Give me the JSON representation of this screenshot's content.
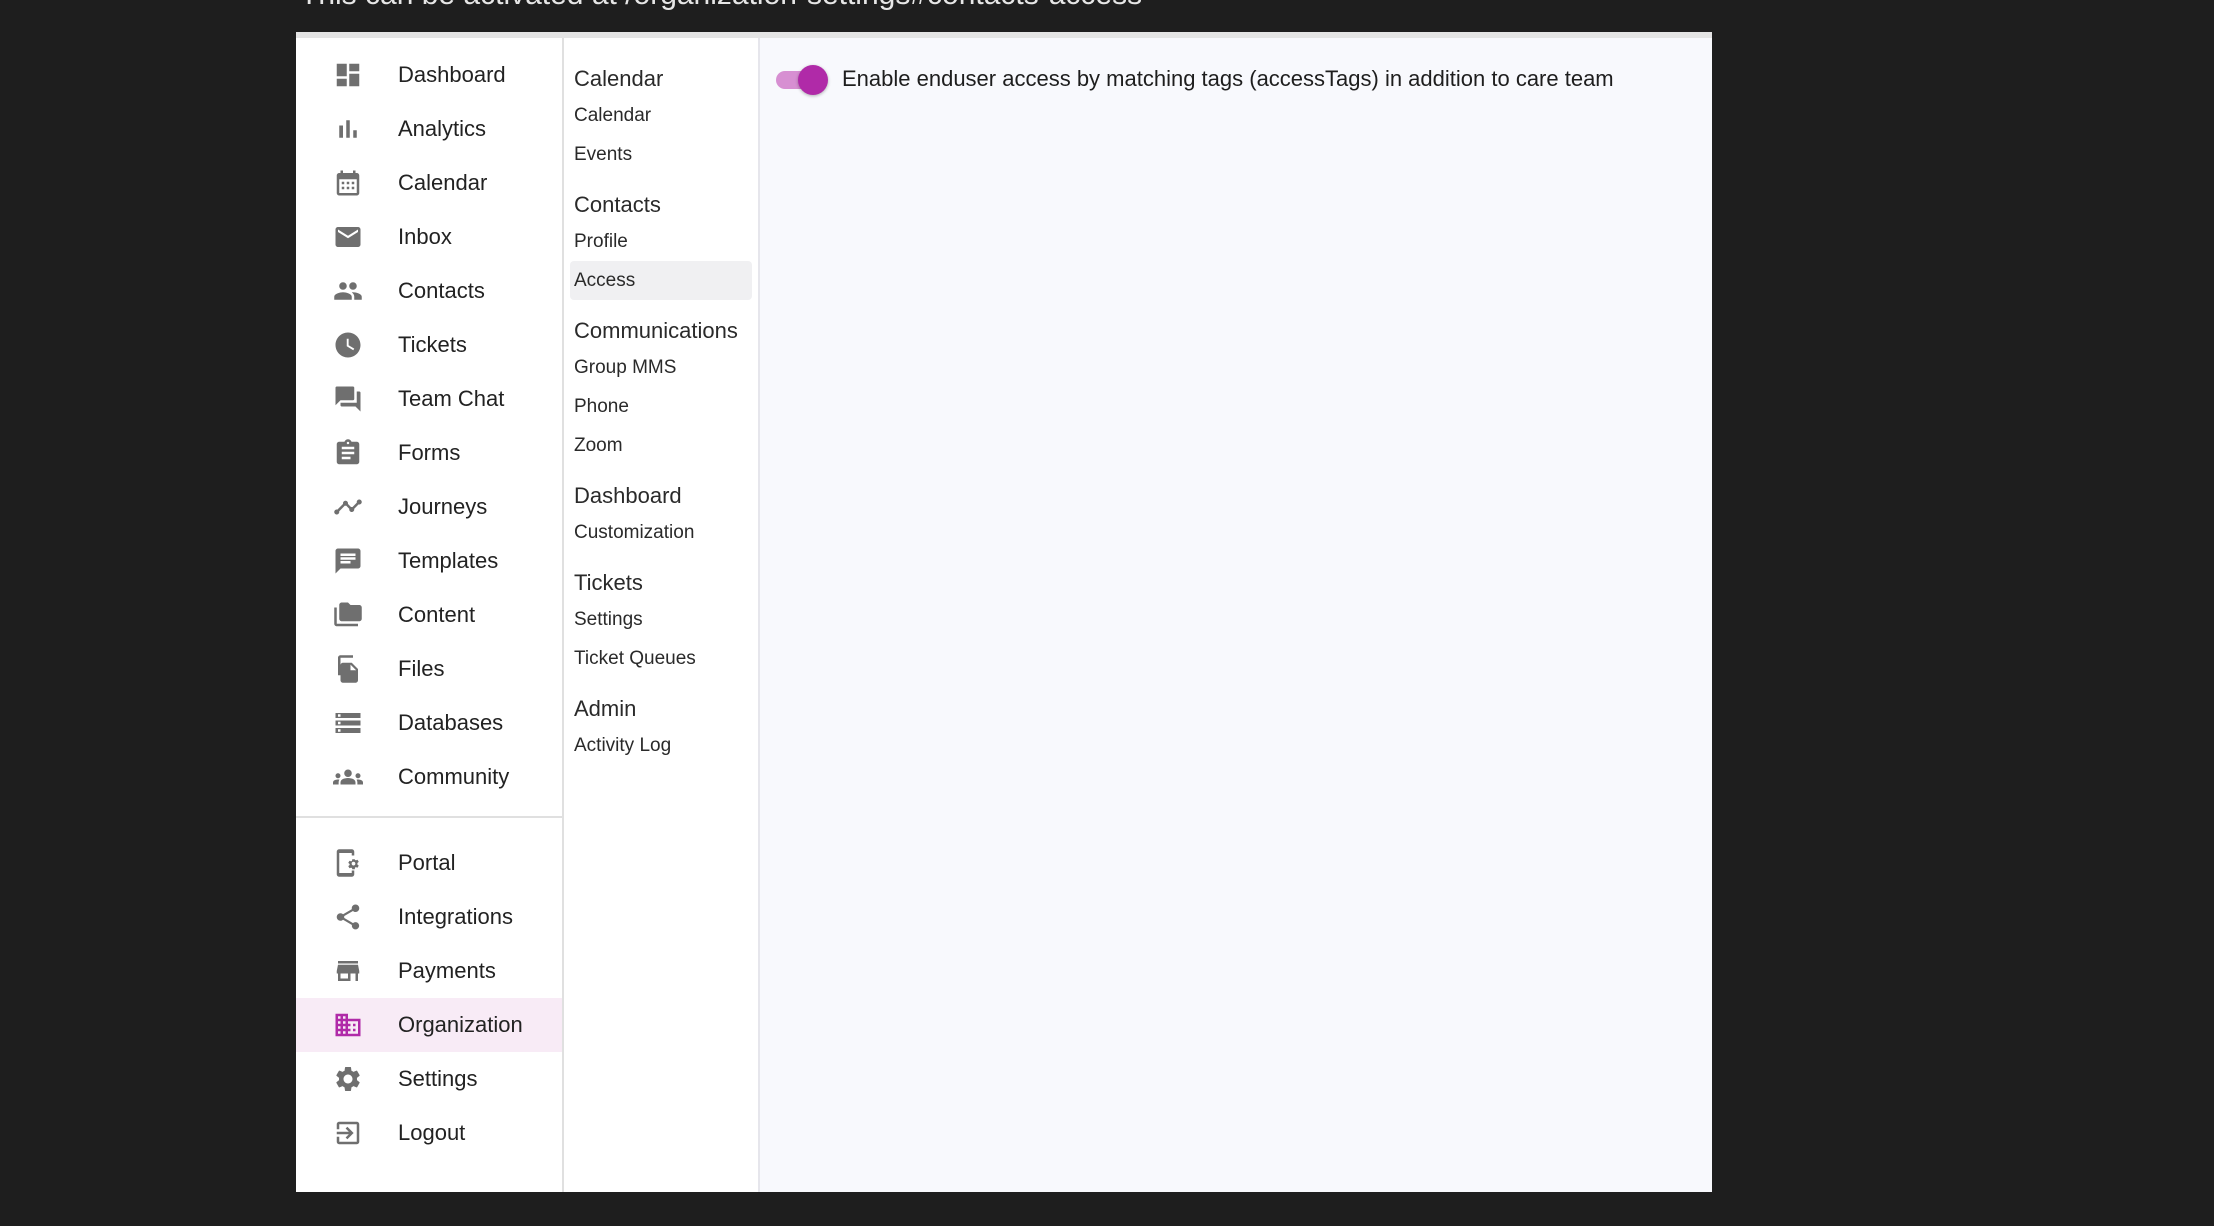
{
  "caption": "This can be activated at /organization-settings#contacts-access",
  "colors": {
    "accent": "#b02aa8",
    "accent_light": "#d78fd2",
    "active_bg": "#f8ebf6"
  },
  "main_nav": {
    "items": [
      {
        "label": "Dashboard",
        "icon": "dashboard-icon"
      },
      {
        "label": "Analytics",
        "icon": "bar-chart-icon"
      },
      {
        "label": "Calendar",
        "icon": "calendar-icon"
      },
      {
        "label": "Inbox",
        "icon": "mail-icon"
      },
      {
        "label": "Contacts",
        "icon": "people-icon"
      },
      {
        "label": "Tickets",
        "icon": "clock-icon"
      },
      {
        "label": "Team Chat",
        "icon": "chat-icon"
      },
      {
        "label": "Forms",
        "icon": "clipboard-icon"
      },
      {
        "label": "Journeys",
        "icon": "trend-icon"
      },
      {
        "label": "Templates",
        "icon": "message-icon"
      },
      {
        "label": "Content",
        "icon": "folders-icon"
      },
      {
        "label": "Files",
        "icon": "files-icon"
      },
      {
        "label": "Databases",
        "icon": "storage-icon"
      },
      {
        "label": "Community",
        "icon": "groups-icon"
      }
    ],
    "secondary_items": [
      {
        "label": "Portal",
        "icon": "phone-settings-icon"
      },
      {
        "label": "Integrations",
        "icon": "share-icon"
      },
      {
        "label": "Payments",
        "icon": "store-icon"
      },
      {
        "label": "Organization",
        "icon": "building-icon"
      },
      {
        "label": "Settings",
        "icon": "gear-icon"
      },
      {
        "label": "Logout",
        "icon": "logout-icon"
      }
    ],
    "active": "Organization"
  },
  "sub_nav": {
    "groups": [
      {
        "title": "Calendar",
        "items": [
          "Calendar",
          "Events"
        ]
      },
      {
        "title": "Contacts",
        "items": [
          "Profile",
          "Access"
        ]
      },
      {
        "title": "Communications",
        "items": [
          "Group MMS",
          "Phone",
          "Zoom"
        ]
      },
      {
        "title": "Dashboard",
        "items": [
          "Customization"
        ]
      },
      {
        "title": "Tickets",
        "items": [
          "Settings",
          "Ticket Queues"
        ]
      },
      {
        "title": "Admin",
        "items": [
          "Activity Log"
        ]
      }
    ],
    "active": "Access"
  },
  "content": {
    "toggle_label": "Enable enduser access by matching tags (accessTags) in addition to care team",
    "toggle_on": true
  }
}
